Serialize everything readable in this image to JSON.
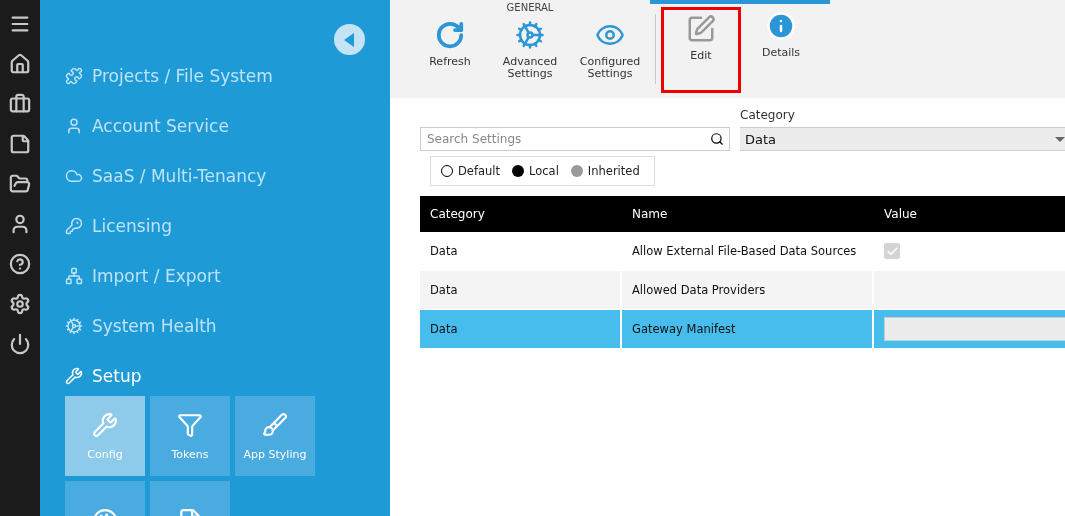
{
  "rail": {
    "items": [
      {
        "kind": "menu"
      },
      {
        "kind": "home"
      },
      {
        "kind": "briefcase"
      },
      {
        "kind": "note"
      },
      {
        "kind": "folder"
      },
      {
        "kind": "user"
      },
      {
        "kind": "help"
      },
      {
        "kind": "settings"
      },
      {
        "kind": "power"
      }
    ]
  },
  "nav": {
    "items": [
      {
        "label": "Projects / File System",
        "expanded": false
      },
      {
        "label": "Account Service",
        "expanded": false
      },
      {
        "label": "SaaS / Multi-Tenancy",
        "expanded": false
      },
      {
        "label": "Licensing",
        "expanded": false
      },
      {
        "label": "Import / Export",
        "expanded": false
      },
      {
        "label": "System Health",
        "expanded": false
      },
      {
        "label": "Setup",
        "expanded": true
      }
    ],
    "tiles": [
      {
        "label": "Config",
        "selected": true
      },
      {
        "label": "Tokens",
        "selected": false
      },
      {
        "label": "App Styling",
        "selected": false
      },
      {
        "selected": false
      },
      {
        "selected": false
      }
    ]
  },
  "toolbar": {
    "group_label": "GENERAL",
    "buttons": [
      {
        "label": "Refresh",
        "highlighted": false
      },
      {
        "label": "Advanced Settings",
        "highlighted": false
      },
      {
        "label": "Configured Settings",
        "highlighted": false
      },
      {
        "label": "Edit",
        "highlighted": true
      },
      {
        "label": "Details",
        "highlighted": false
      }
    ]
  },
  "filters": {
    "search": {
      "placeholder": "Search Settings"
    },
    "category": {
      "label": "Category",
      "value": "Data"
    },
    "legend": [
      {
        "label": "Default",
        "kind": "hollow"
      },
      {
        "label": "Local",
        "kind": "solid"
      },
      {
        "label": "Inherited",
        "kind": "muted"
      }
    ]
  },
  "table": {
    "columns": [
      "Category",
      "Name",
      "Value"
    ],
    "rows": [
      {
        "category": "Data",
        "name": "Allow External File-Based Data Sources",
        "value": {
          "kind": "checkbox",
          "checked": true
        },
        "selected": false
      },
      {
        "category": "Data",
        "name": "Allowed Data Providers",
        "value": {
          "kind": "empty"
        },
        "selected": false
      },
      {
        "category": "Data",
        "name": "Gateway Manifest",
        "value": {
          "kind": "field"
        },
        "selected": true
      }
    ]
  }
}
